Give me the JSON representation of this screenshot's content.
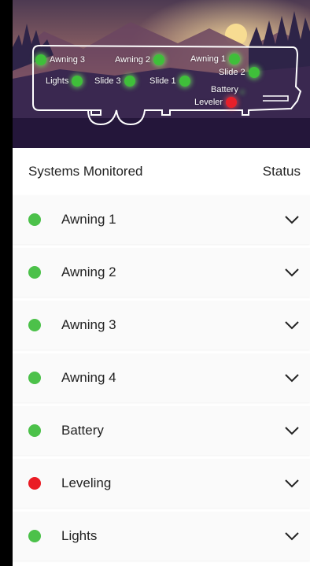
{
  "hero": {
    "markers": [
      {
        "label": "Awning 3",
        "status": "ok"
      },
      {
        "label": "Awning 2",
        "status": "ok"
      },
      {
        "label": "Awning 1",
        "status": "ok"
      },
      {
        "label": "Slide 2",
        "status": "ok"
      },
      {
        "label": "Lights",
        "status": "ok"
      },
      {
        "label": "Slide 3",
        "status": "ok"
      },
      {
        "label": "Slide 1",
        "status": "ok"
      },
      {
        "label": "Battery",
        "status": "ok"
      },
      {
        "label": "Leveler",
        "status": "error"
      }
    ]
  },
  "header": {
    "systems_label": "Systems Monitored",
    "status_label": "Status"
  },
  "systems": [
    {
      "name": "Awning 1",
      "status": "ok",
      "icon": "chevron-down-icon"
    },
    {
      "name": "Awning 2",
      "status": "ok",
      "icon": "chevron-down-icon"
    },
    {
      "name": "Awning 3",
      "status": "ok",
      "icon": "chevron-down-icon"
    },
    {
      "name": "Awning 4",
      "status": "ok",
      "icon": "chevron-down-icon"
    },
    {
      "name": "Battery",
      "status": "ok",
      "icon": "chevron-down-icon"
    },
    {
      "name": "Leveling",
      "status": "error",
      "icon": "chevron-down-icon"
    },
    {
      "name": "Lights",
      "status": "ok",
      "icon": "chevron-down-icon"
    }
  ],
  "colors": {
    "ok": "#4cc14a",
    "error": "#ea1c24",
    "sky_top": "#5a3e55",
    "sky_glow": "#f3c98a"
  }
}
